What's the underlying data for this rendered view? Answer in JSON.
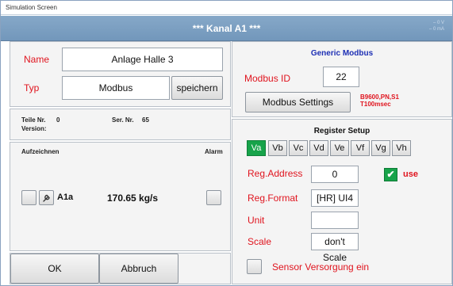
{
  "window": {
    "title": "Simulation Screen"
  },
  "header": {
    "title": "*** Kanal A1 ***",
    "status_line1": "– 0 V",
    "status_line2": "– 0 mA"
  },
  "channel": {
    "name_label": "Name",
    "name_value": "Anlage Halle 3",
    "type_label": "Typ",
    "type_value": "Modbus",
    "save_label": "speichern"
  },
  "info": {
    "part_no_label": "Teile Nr.",
    "part_no_value": "0",
    "serial_no_label": "Ser. Nr.",
    "serial_no_value": "65",
    "version_label": "Version:"
  },
  "record": {
    "record_label": "Aufzeichnen",
    "alarm_label": "Alarm",
    "channel_tag": "A1a",
    "value": "170.65 kg/s"
  },
  "footer": {
    "ok_label": "OK",
    "cancel_label": "Abbruch"
  },
  "modbus": {
    "title": "Generic Modbus",
    "id_label": "Modbus ID",
    "id_value": "22",
    "settings_label": "Modbus Settings",
    "settings_info_line1": "B9600,PN,S1",
    "settings_info_line2": "T100msec"
  },
  "register": {
    "title": "Register Setup",
    "tabs": [
      "Va",
      "Vb",
      "Vc",
      "Vd",
      "Ve",
      "Vf",
      "Vg",
      "Vh"
    ],
    "active_tab": "Va",
    "address_label": "Reg.Address",
    "address_value": "0",
    "use_label": "use",
    "use_checked": true,
    "format_label": "Reg.Format",
    "format_value": "[HR] UI4",
    "unit_label": "Unit",
    "unit_value": "",
    "scale_label": "Scale",
    "scale_value": "don't Scale",
    "sensor_supply_label": "Sensor Versorgung ein"
  },
  "colors": {
    "accent_red": "#e0141e",
    "header_blue": "#7f9fc1",
    "active_green": "#17a34a",
    "title_blue": "#1d2fb4"
  },
  "icons": {
    "channel_icon": "wrench-icon",
    "check_icon": "check-icon"
  }
}
